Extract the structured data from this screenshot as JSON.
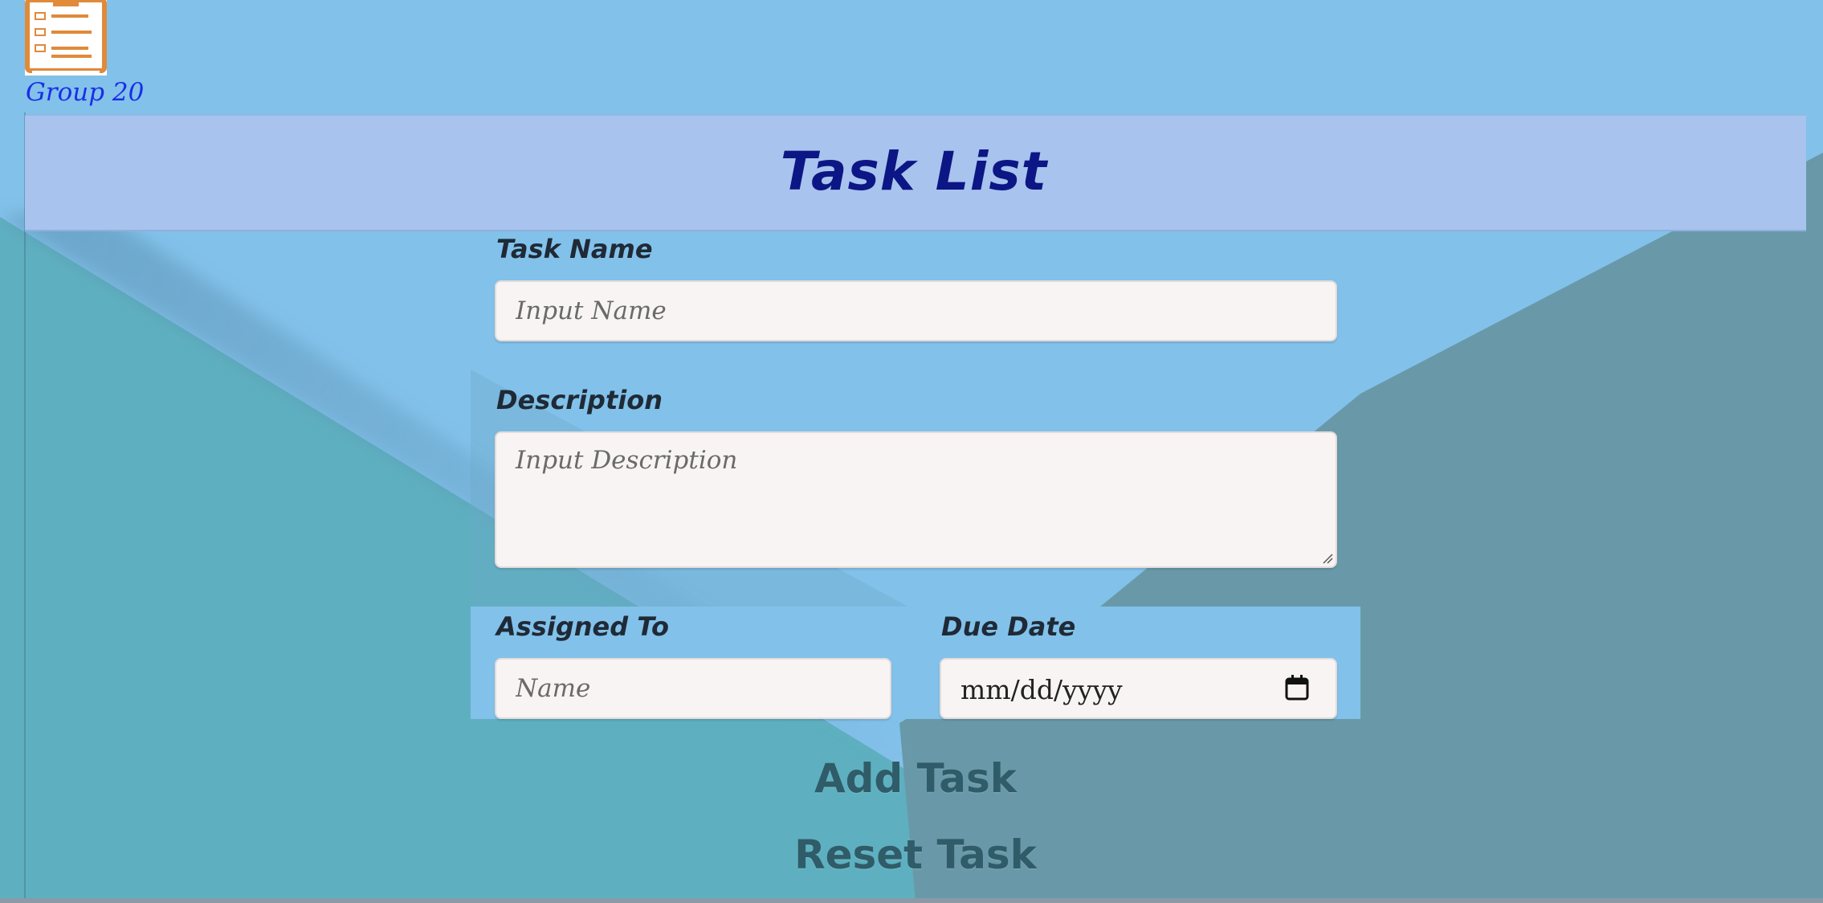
{
  "brand": {
    "group_label": "Group 20",
    "logo_icon": "clipboard-checklist-icon",
    "logo_color": "#e08a3a"
  },
  "header": {
    "title": "Task List",
    "background": "#a8c3ed",
    "title_color": "#0c1685"
  },
  "form": {
    "task_name": {
      "label": "Task Name",
      "value": "",
      "placeholder": "Input Name"
    },
    "description": {
      "label": "Description",
      "value": "",
      "placeholder": "Input Description"
    },
    "assigned_to": {
      "label": "Assigned To",
      "value": "",
      "placeholder": "Name"
    },
    "due_date": {
      "label": "Due Date",
      "display": "mm/dd/yyyy",
      "icon": "calendar-icon"
    }
  },
  "actions": {
    "add_label": "Add Task",
    "reset_label": "Reset Task"
  },
  "colors": {
    "sky": "#82c1ea",
    "teal": "#5eb0c0",
    "slate": "#6999a9"
  }
}
